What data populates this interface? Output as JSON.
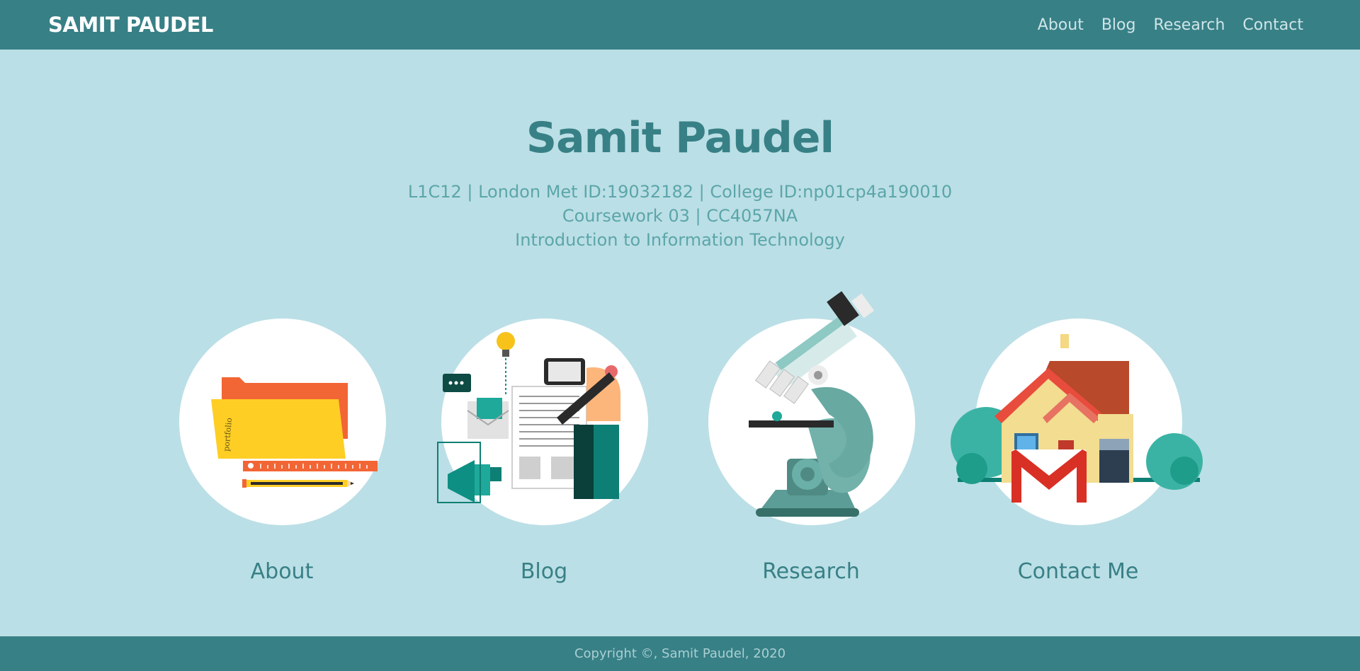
{
  "nav": {
    "brand": "SAMIT PAUDEL",
    "links": [
      "About",
      "Blog",
      "Research",
      "Contact"
    ]
  },
  "hero": {
    "title": "Samit Paudel",
    "line1": "L1C12 | London Met ID:19032182 | College ID:np01cp4a190010",
    "line2": "Coursework 03 | CC4057NA",
    "line3": "Introduction to Information Technology"
  },
  "cards": [
    {
      "label": "About",
      "icon": "folder-portfolio-icon",
      "folder_text": "portfolio"
    },
    {
      "label": "Blog",
      "icon": "blog-writing-icon"
    },
    {
      "label": "Research",
      "icon": "microscope-icon"
    },
    {
      "label": "Contact Me",
      "icon": "house-mail-icon"
    }
  ],
  "footer": {
    "copyright": "Copyright ©, Samit Paudel, 2020"
  },
  "colors": {
    "nav_bg": "#378086",
    "page_bg": "#bbdfe6",
    "title": "#378086",
    "subtitle": "#5ba6aa"
  }
}
